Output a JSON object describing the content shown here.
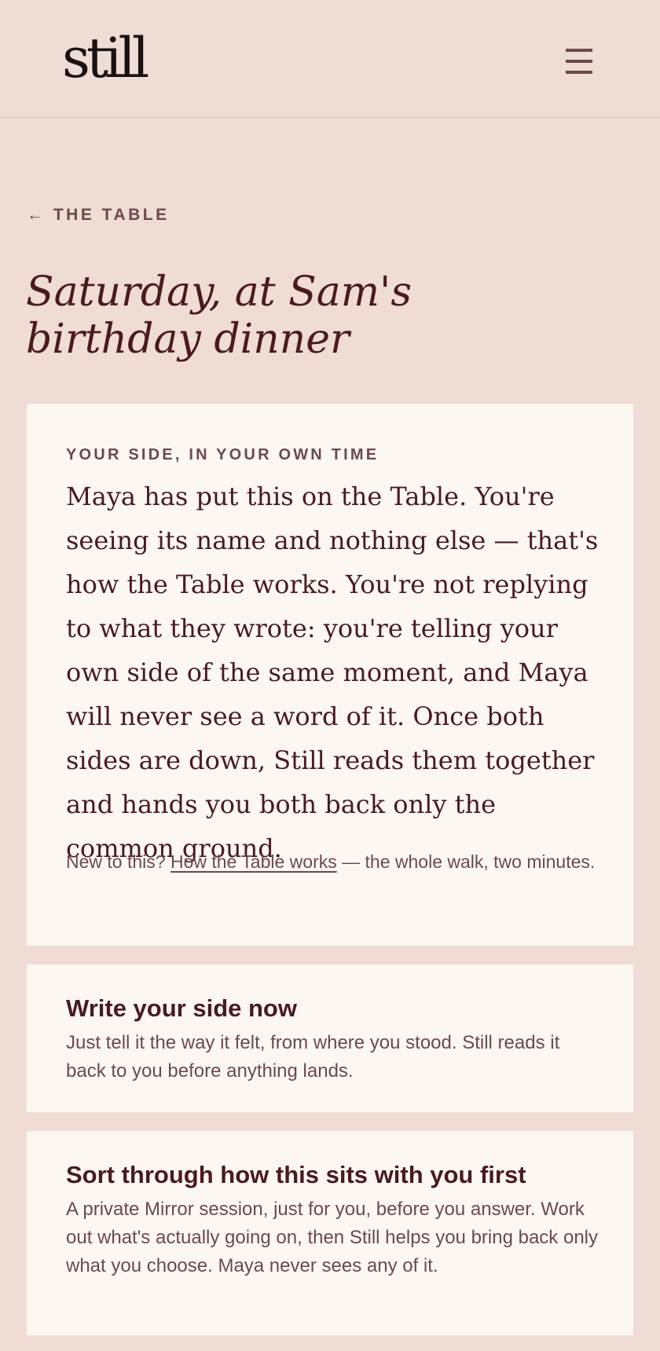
{
  "header": {
    "logo_text": "still",
    "menu_icon": "hamburger-menu-icon"
  },
  "nav": {
    "back_arrow": "←",
    "back_label": "THE TABLE"
  },
  "page": {
    "title_line1": "Saturday, at Sam's",
    "title_line2": "birthday dinner"
  },
  "intro_card": {
    "eyebrow": "YOUR SIDE, IN YOUR OWN TIME",
    "body": "Maya has put this on the Table. You're seeing its name and nothing else — that's how the Table works. You're not replying to what they wrote: you're telling your own side of the same moment, and Maya will never see a word of it. Once both sides are down, Still reads them together and hands you both back only the common ground.",
    "note_prefix": "New to this? ",
    "note_link": "How the Table works",
    "note_suffix": " — the whole walk, two minutes."
  },
  "options": {
    "write": {
      "title": "Write your side now",
      "description": "Just tell it the way it felt, from where you stood. Still reads it back to you before anything lands."
    },
    "mirror": {
      "title": "Sort through how this sits with you first",
      "description": "A private Mirror session, just for you, before you answer. Work out what's actually going on, then Still helps you bring back only what you choose. Maya never sees any of it."
    }
  },
  "colors": {
    "background": "#efdcd4",
    "card": "#fdf7f4",
    "heading": "#4a1a20",
    "muted": "#6b4a4e"
  }
}
